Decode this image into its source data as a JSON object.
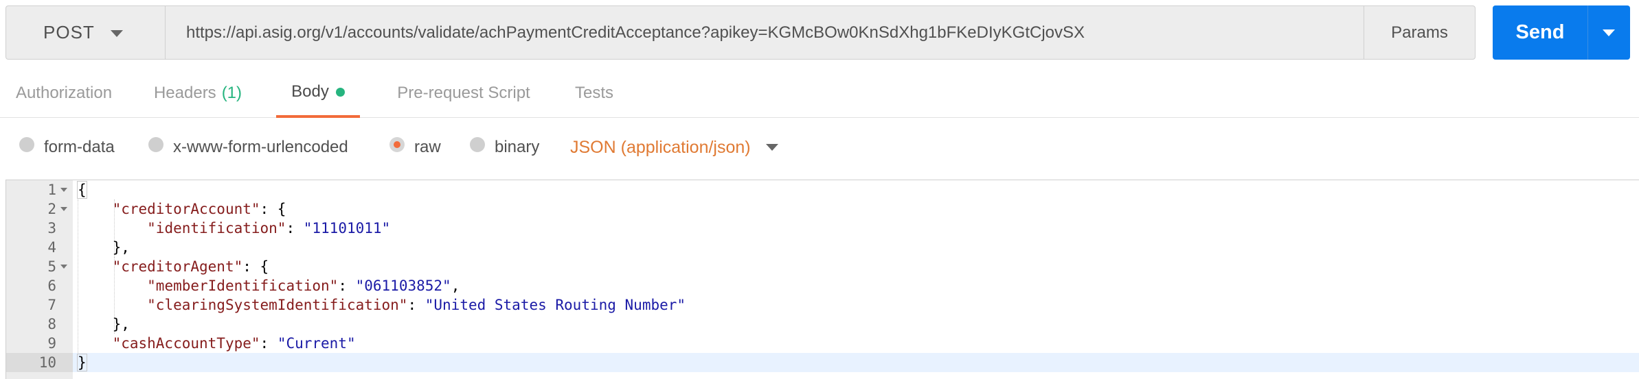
{
  "request": {
    "method": "POST",
    "url": "https://api.asig.org/v1/accounts/validate/achPaymentCreditAcceptance?apikey=KGMcBOw0KnSdXhg1bFKeDIyKGtCjovSX",
    "params_label": "Params",
    "send_label": "Send"
  },
  "tabs": [
    {
      "label": "Authorization"
    },
    {
      "label": "Headers",
      "count": "(1)"
    },
    {
      "label": "Body"
    },
    {
      "label": "Pre-request Script"
    },
    {
      "label": "Tests"
    }
  ],
  "body_options": {
    "form_data": "form-data",
    "urlencoded": "x-www-form-urlencoded",
    "raw": "raw",
    "binary": "binary",
    "selected": "raw",
    "format": "JSON (application/json)"
  },
  "editor": {
    "line_numbers": [
      "1",
      "2",
      "3",
      "4",
      "5",
      "6",
      "7",
      "8",
      "9",
      "10"
    ],
    "lines": {
      "l1": {
        "p1": "{"
      },
      "l2": {
        "key": "\"creditorAccount\"",
        "p1": ": {"
      },
      "l3": {
        "key": "\"identification\"",
        "p1": ": ",
        "val": "\"11101011\""
      },
      "l4": {
        "p1": "},"
      },
      "l5": {
        "key": "\"creditorAgent\"",
        "p1": ": {"
      },
      "l6": {
        "key": "\"memberIdentification\"",
        "p1": ": ",
        "val": "\"061103852\"",
        "p2": ","
      },
      "l7": {
        "key": "\"clearingSystemIdentification\"",
        "p1": ": ",
        "val": "\"United States Routing Number\""
      },
      "l8": {
        "p1": "},"
      },
      "l9": {
        "key": "\"cashAccountType\"",
        "p1": ": ",
        "val": "\"Current\""
      },
      "l10": {
        "p1": "}"
      }
    }
  },
  "colors": {
    "accent": "#F26B3A",
    "send": "#097BED",
    "success": "#26b47f",
    "json_key": "#851c1c",
    "json_string": "#1a1aa6"
  }
}
